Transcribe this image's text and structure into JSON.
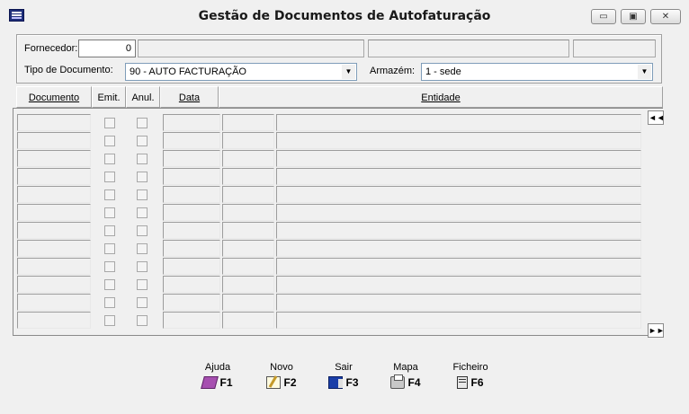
{
  "window": {
    "title": "Gestão de Documentos de Autofaturação",
    "min_symbol": "▭",
    "max_symbol": "▣",
    "close_symbol": "✕"
  },
  "filters": {
    "fornecedor_label": "Fornecedor:",
    "fornecedor_value": "0",
    "tipo_label": "Tipo de Documento:",
    "tipo_value": "90 - AUTO FACTURAÇÃO",
    "armazem_label": "Armazém:",
    "armazem_value": "1 - sede"
  },
  "table": {
    "columns": [
      "Documento",
      "Emit.",
      "Anul.",
      "Data",
      "",
      "Entidade"
    ],
    "row_count": 12,
    "nav_first": "◄◄",
    "nav_last": "►►"
  },
  "function_keys": [
    {
      "caption": "Ajuda",
      "key": "F1",
      "icon": "help-book-icon"
    },
    {
      "caption": "Novo",
      "key": "F2",
      "icon": "new-document-icon"
    },
    {
      "caption": "Sair",
      "key": "F3",
      "icon": "exit-icon"
    },
    {
      "caption": "Mapa",
      "key": "F4",
      "icon": "print-icon"
    },
    {
      "caption": "Ficheiro",
      "key": "F6",
      "icon": "file-cabinet-icon"
    }
  ]
}
